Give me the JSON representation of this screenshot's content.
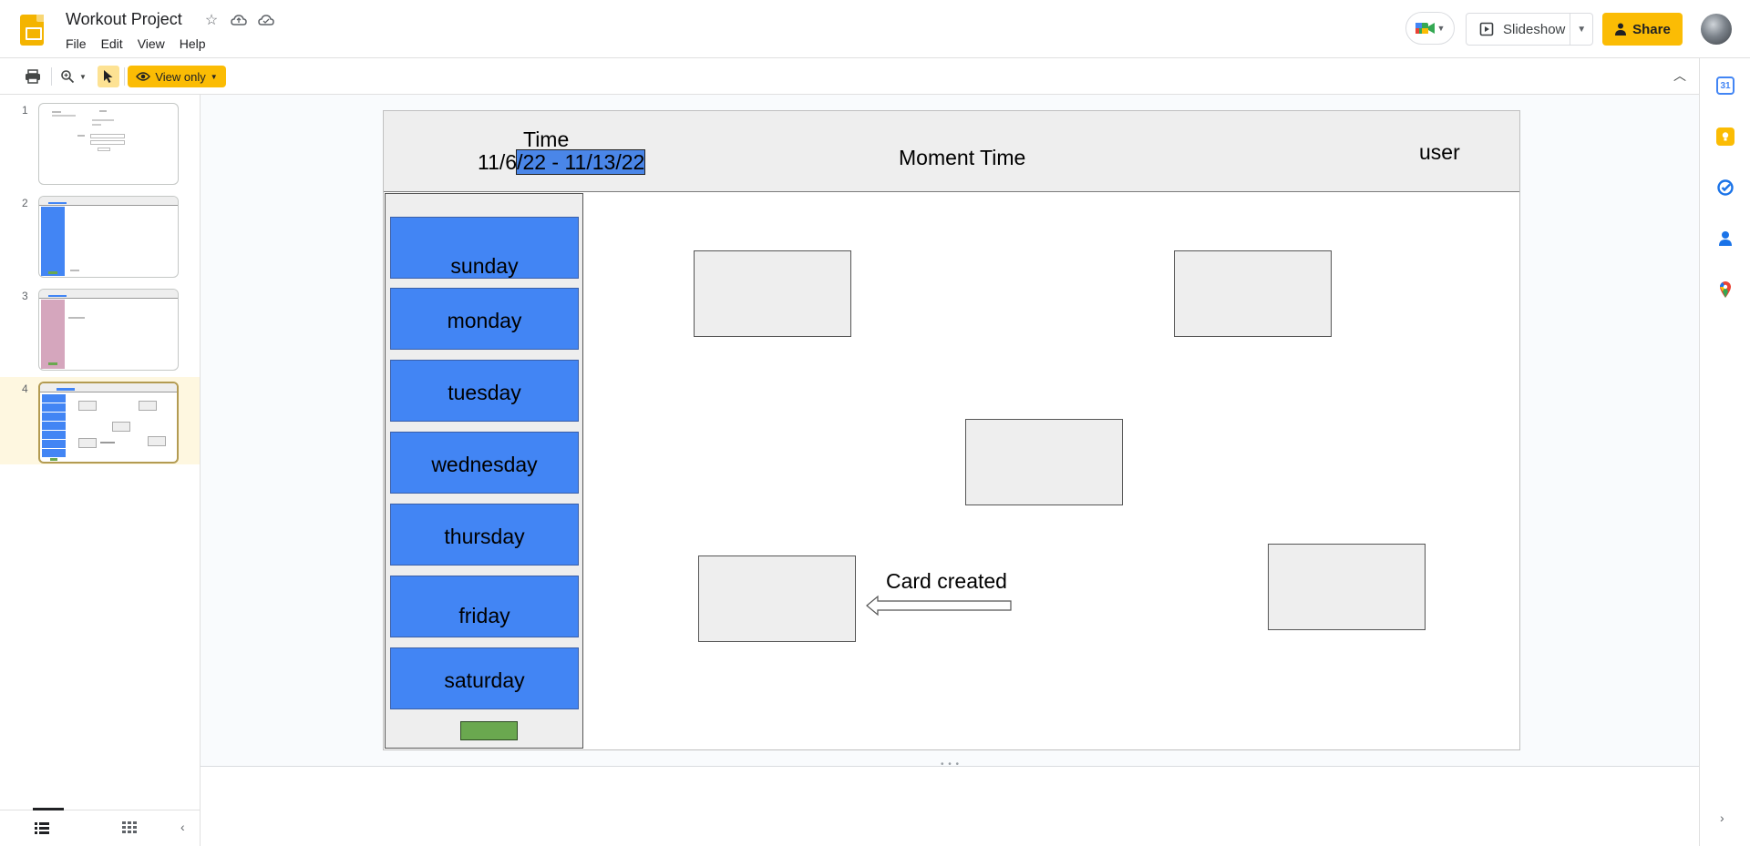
{
  "app": {
    "doc_title": "Workout Project",
    "menu": [
      "File",
      "Edit",
      "View",
      "Help"
    ],
    "slideshow_label": "Slideshow",
    "share_label": "Share"
  },
  "toolbar": {
    "view_only_label": "View only"
  },
  "filmstrip": {
    "slides": [
      {
        "number": "1"
      },
      {
        "number": "2"
      },
      {
        "number": "3"
      },
      {
        "number": "4"
      }
    ],
    "selected_slide": "4"
  },
  "side_panel": {
    "calendar_day": "31"
  },
  "slide": {
    "header": {
      "time_label": "Time",
      "date_range_prefix": "11/6",
      "date_range_selected": "/22 - 11/13/22",
      "app_title": "Moment Time",
      "user_label": "user"
    },
    "days": [
      "sunday",
      "monday",
      "tuesday",
      "wednesday",
      "thursday",
      "friday",
      "saturday"
    ],
    "card_caption": "Card created"
  },
  "colors": {
    "brand_yellow": "#fbbc04",
    "day_blue": "#4285f4",
    "selection_blue": "#4a86e8",
    "button_green": "#6aa84f",
    "card_gray": "#eeeeee",
    "active_thumb_bg": "#fef7e0"
  },
  "icons": {
    "header": [
      "slides-logo-icon",
      "star-icon",
      "move-to-drive-icon",
      "cloud-saved-icon",
      "meet-icon",
      "slideshow-icon",
      "share-lock-icon",
      "avatar"
    ],
    "toolbar": [
      "print-icon",
      "zoom-icon",
      "select-cursor-icon",
      "eye-icon",
      "collapse-toolbar-icon"
    ],
    "side_panel": [
      "calendar-icon",
      "keep-icon",
      "tasks-icon",
      "contacts-icon",
      "maps-icon",
      "expand-panel-icon"
    ],
    "filmstrip_footer": [
      "list-view-icon",
      "grid-view-icon",
      "collapse-filmstrip-icon"
    ]
  }
}
